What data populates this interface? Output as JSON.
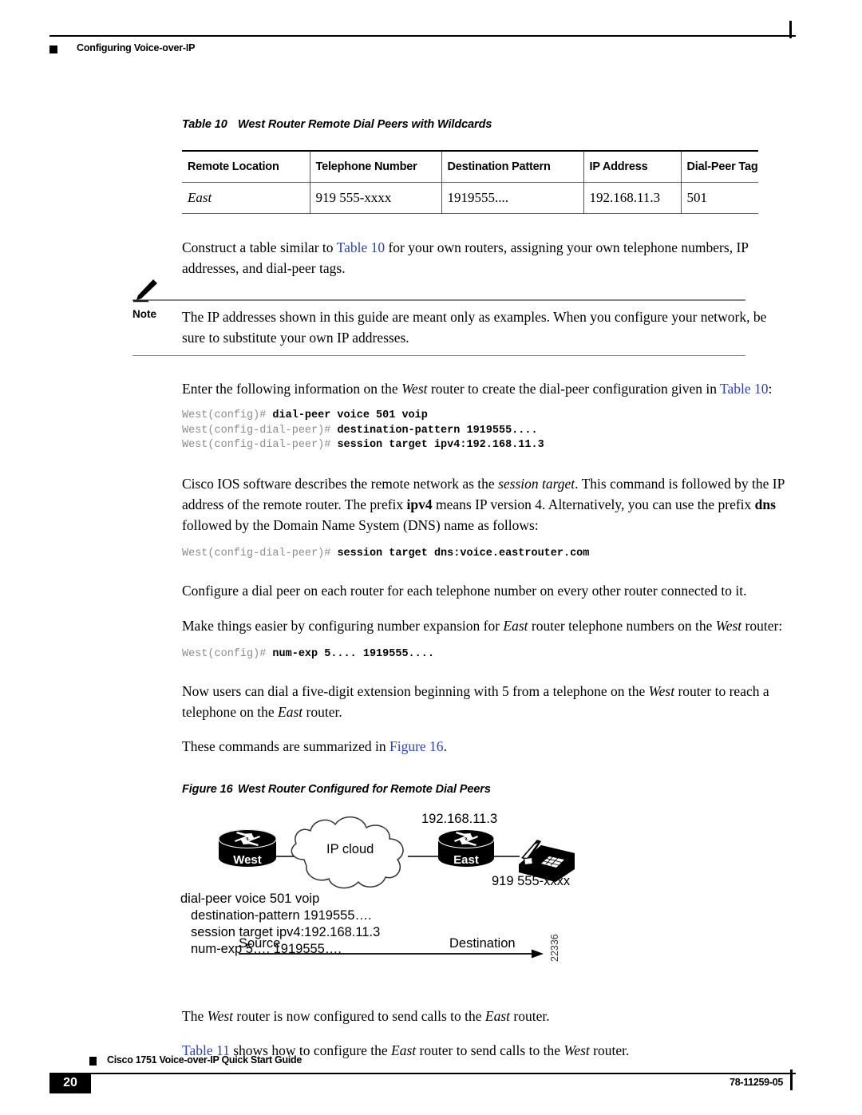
{
  "header": {
    "title": "Configuring Voice-over-IP"
  },
  "table": {
    "caption_number": "Table 10",
    "caption_title": "West Router Remote Dial Peers with Wildcards",
    "columns": [
      "Remote Location",
      "Telephone Number",
      "Destination Pattern",
      "IP Address",
      "Dial-Peer Tag"
    ],
    "rows": [
      {
        "remote_location": "East",
        "telephone_number": "919 555-xxxx",
        "destination_pattern": "1919555....",
        "ip_address": "192.168.11.3",
        "dial_peer_tag": "501"
      }
    ]
  },
  "paragraphs": {
    "construct_1": "Construct a table similar to ",
    "construct_link": "Table 10",
    "construct_2": " for your own routers, assigning your own telephone numbers, IP addresses, and dial-peer tags.",
    "enter_1": "Enter the following information on the ",
    "enter_italic": "West",
    "enter_2": " router to create the dial-peer configuration given in ",
    "enter_link": "Table 10",
    "enter_3": ":",
    "ios_1": "Cisco IOS software describes the remote network as the ",
    "ios_italic1": "session target",
    "ios_2": ". This command is followed by the IP address of the remote router. The prefix ",
    "ios_bold1": "ipv4",
    "ios_3": " means IP version 4. Alternatively, you can use the prefix ",
    "ios_bold2": "dns",
    "ios_4": " followed by the Domain Name System (DNS) name as follows:",
    "configure_peer": "Configure a dial peer on each router for each telephone number on every other router connected to it.",
    "make_easier_1": "Make things easier by configuring number expansion for ",
    "make_easier_italic1": "East",
    "make_easier_2": " router telephone numbers on the ",
    "make_easier_italic2": "West",
    "make_easier_3": " router:",
    "now_users_1": "Now users can dial a five-digit extension beginning with 5 from a telephone on the ",
    "now_users_italic1": "West",
    "now_users_2": " router to reach a telephone on the ",
    "now_users_italic2": "East",
    "now_users_3": " router.",
    "summarized_1": "These commands are summarized in ",
    "summarized_link": "Figure 16",
    "summarized_2": ".",
    "west_configured_1": "The ",
    "west_configured_italic1": "West",
    "west_configured_2": " router is now configured to send calls to the ",
    "west_configured_italic2": "East",
    "west_configured_3": " router.",
    "table11_link": "Table 11",
    "table11_1": " shows how to configure the ",
    "table11_italic1": "East",
    "table11_2": " router to send calls to the ",
    "table11_italic2": "West",
    "table11_3": " router."
  },
  "note": {
    "label": "Note",
    "text": "The IP addresses shown in this guide are meant only as examples. When you configure your network, be sure to substitute your own IP addresses."
  },
  "cli_blocks": {
    "dial_peer": [
      {
        "prompt": "West(config)# ",
        "command": "dial-peer voice 501 voip"
      },
      {
        "prompt": "West(config-dial-peer)# ",
        "command": "destination-pattern 1919555...."
      },
      {
        "prompt": "West(config-dial-peer)# ",
        "command": "session target ipv4:192.168.11.3"
      }
    ],
    "dns_target": [
      {
        "prompt": "West(config-dial-peer)# ",
        "command": "session target dns:voice.eastrouter.com"
      }
    ],
    "num_exp": [
      {
        "prompt": "West(config)# ",
        "command": "num-exp 5.... 1919555...."
      }
    ]
  },
  "figure": {
    "caption_number": "Figure 16",
    "caption_title": "West Router Configured for Remote Dial Peers",
    "left_router_label": "West",
    "right_router_label": "East",
    "cloud_label": "IP cloud",
    "ip_address": "192.168.11.3",
    "phone_number": "919 555-xxxx",
    "config_lines": [
      "dial-peer voice 501 voip",
      "destination-pattern 1919555….",
      "session target ipv4:192.168.11.3",
      "num-exp 5…. 1919555…."
    ],
    "source_label": "Source",
    "destination_label": "Destination",
    "figure_id": "22336"
  },
  "footer": {
    "guide_title": "Cisco 1751 Voice-over-IP Quick Start Guide",
    "page_number": "20",
    "doc_number": "78-11259-05"
  }
}
